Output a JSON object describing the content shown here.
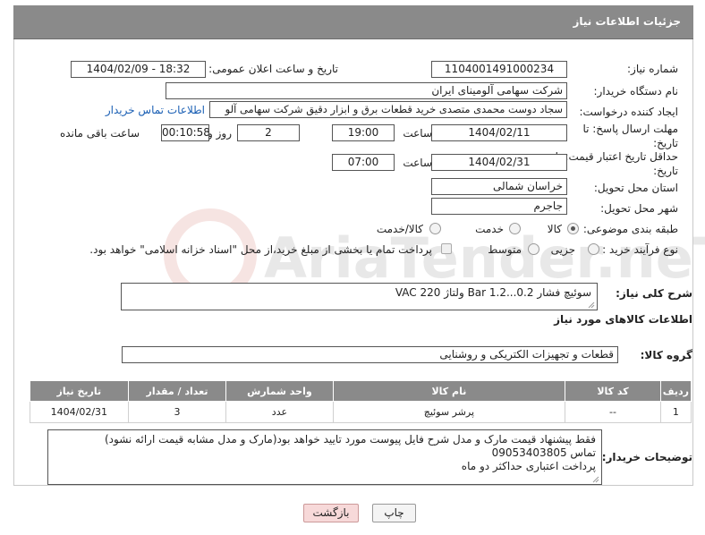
{
  "header": {
    "title": "جزئیات اطلاعات نیاز"
  },
  "fields": {
    "need_number_label": "شماره نیاز:",
    "need_number": "1104001491000234",
    "announce_label": "تاریخ و ساعت اعلان عمومی:",
    "announce_value": "1404/02/09 - 18:32",
    "buyer_org_label": "نام دستگاه خریدار:",
    "buyer_org": "شرکت سهامی آلومینای ایران",
    "creator_label": "ایجاد کننده درخواست:",
    "creator": "سجاد دوست محمدی متصدی خرید قطعات برق و ابزار دقیق شرکت سهامی آلو",
    "contact_link": "اطلاعات تماس خریدار",
    "reply_deadline_label": "مهلت ارسال پاسخ: تا تاریخ:",
    "reply_date": "1404/02/11",
    "time_label": "ساعت",
    "reply_time": "19:00",
    "days_value": "2",
    "days_label": "روز و",
    "remaining_time": "00:10:58",
    "remaining_label": "ساعت باقی مانده",
    "price_validity_label": "حداقل تاریخ اعتبار قیمت: تا تاریخ:",
    "validity_date": "1404/02/31",
    "validity_time_label": "ساعت",
    "validity_time": "07:00",
    "province_label": "استان محل تحویل:",
    "province": "خراسان شمالی",
    "city_label": "شهر محل تحویل:",
    "city": "جاجرم",
    "category_label": "طبقه بندی موضوعی:",
    "category_options": [
      "کالا",
      "خدمت",
      "کالا/خدمت"
    ],
    "process_label": "نوع فرآیند خرید :",
    "process_options": [
      "جزیی",
      "متوسط"
    ],
    "process_note": "پرداخت تمام یا بخشی از مبلغ خرید،از محل \"اسناد خزانه اسلامی\" خواهد بود."
  },
  "description": {
    "label": "شرح کلی نیاز:",
    "value": "سوئیچ فشار Bar 1.2...0.2 ولتاژ VAC 220"
  },
  "goods_section": {
    "title": "اطلاعات کالاهای مورد نیاز",
    "group_label": "گروه کالا:",
    "group_value": "قطعات و تجهیزات الکتریکی و روشنایی"
  },
  "table": {
    "headers": [
      "ردیف",
      "کد کالا",
      "نام کالا",
      "واحد شمارش",
      "تعداد / مقدار",
      "تاریخ نیاز"
    ],
    "rows": [
      [
        "1",
        "--",
        "پرشر سوئیچ",
        "عدد",
        "3",
        "1404/02/31"
      ]
    ]
  },
  "buyer_notes": {
    "label": "توضیحات خریدار:",
    "lines": [
      "فقط پیشنهاد قیمت مارک و مدل شرح فایل پیوست مورد تایید خواهد بود(مارک و مدل مشابه قیمت ارائه نشود)",
      "تماس 09053403805",
      "پرداخت اعتباری حداکثر دو ماه"
    ]
  },
  "buttons": {
    "print": "چاپ",
    "back": "بازگشت"
  },
  "watermark": {
    "text": "AriaTender.neT"
  },
  "colors": {
    "header_bg": "#8a8a8a",
    "link": "#1a5fb4",
    "back_button_bg": "#f7d9d9"
  }
}
